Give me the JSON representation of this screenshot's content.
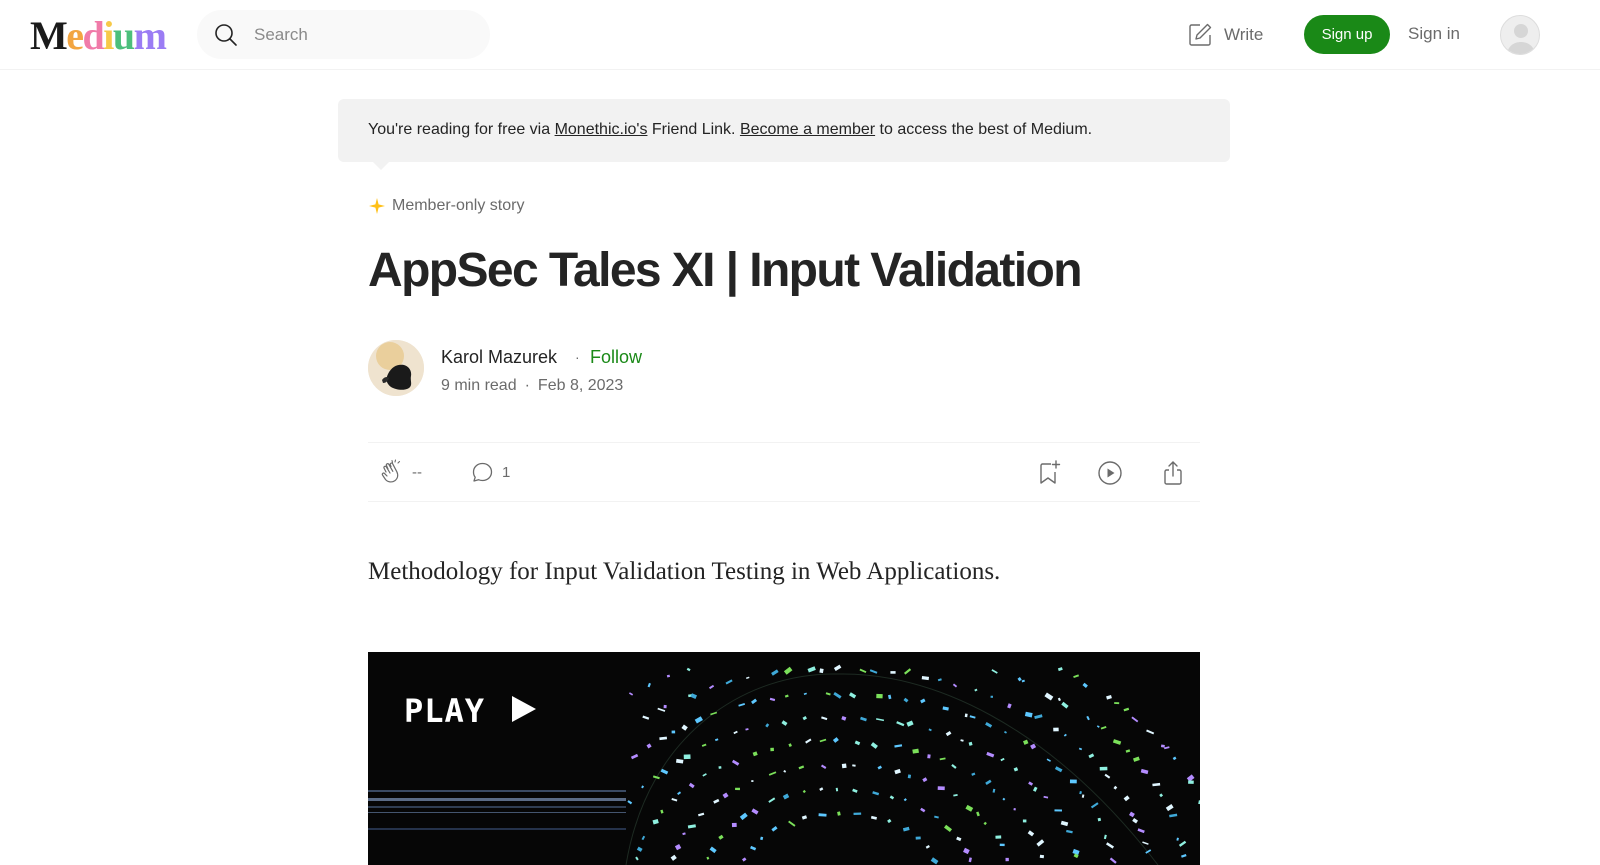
{
  "header": {
    "logo_text": "Medium",
    "search_placeholder": "Search",
    "write_label": "Write",
    "signup_label": "Sign up",
    "signin_label": "Sign in"
  },
  "banner": {
    "prefix": "You're reading for free via ",
    "publisher_link": "Monethic.io's",
    "middle": " Friend Link. ",
    "member_link": "Become a member",
    "suffix": " to access the best of Medium."
  },
  "article": {
    "badge": "Member-only story",
    "title": "AppSec Tales XI | Input Validation",
    "author": "Karol Mazurek",
    "follow_label": "Follow",
    "read_time": "9 min read",
    "date": "Feb 8, 2023",
    "claps": "--",
    "responses": "1",
    "subtitle": "Methodology for Input Validation Testing in Web Applications.",
    "hero_text": "PLAY"
  },
  "colors": {
    "accent_green": "#1a8917",
    "badge_star": "#ffc017",
    "text": "#242424",
    "muted": "#6b6b6b",
    "banner_bg": "#f2f2f2"
  },
  "icons": [
    "search-icon",
    "write-icon",
    "avatar-icon",
    "star-icon",
    "clap-icon",
    "response-icon",
    "bookmark-icon",
    "play-icon",
    "share-icon"
  ]
}
